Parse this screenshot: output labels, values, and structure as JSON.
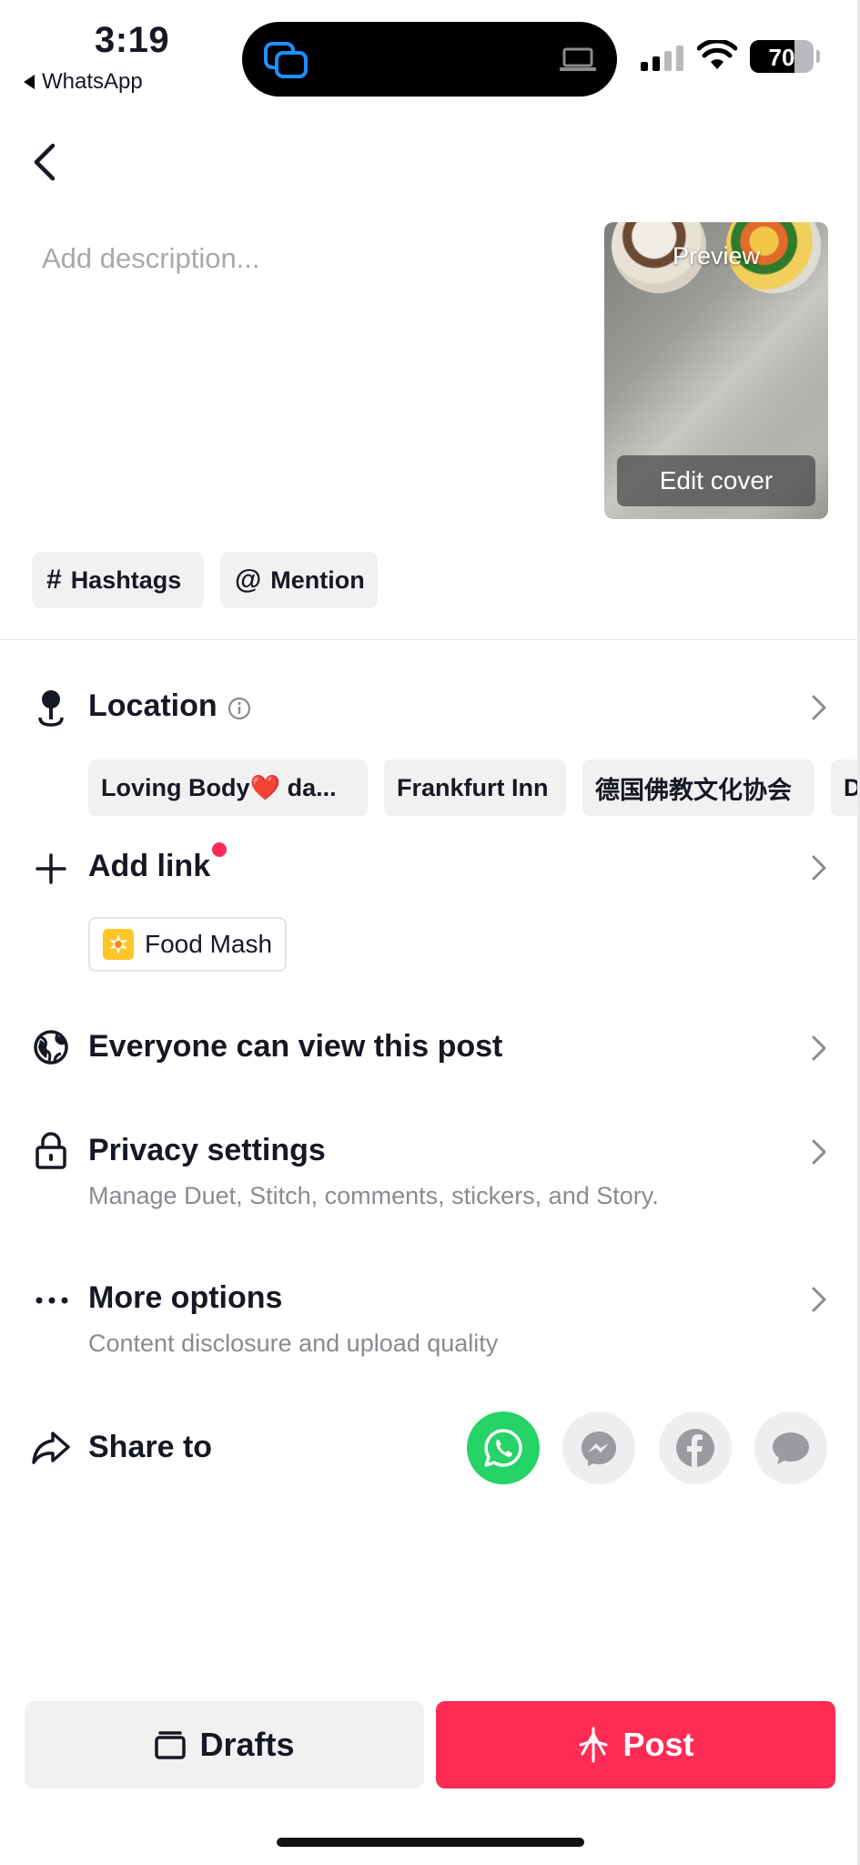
{
  "status_bar": {
    "time": "3:19",
    "back_app": "WhatsApp",
    "battery": "70",
    "battery_level": 0.7
  },
  "description": {
    "placeholder": "Add description..."
  },
  "cover": {
    "preview_label": "Preview",
    "edit_label": "Edit cover"
  },
  "chips": {
    "hashtags": "Hashtags",
    "mention": "Mention"
  },
  "location": {
    "title": "Location",
    "suggestions": [
      "Loving Body❤️ da...",
      "Frankfurt Inn",
      "德国佛教文化协会",
      "D"
    ]
  },
  "add_link": {
    "title": "Add link",
    "item": "Food Mash"
  },
  "visibility": {
    "title": "Everyone can view this post"
  },
  "privacy": {
    "title": "Privacy settings",
    "subtitle": "Manage Duet, Stitch, comments, stickers, and Story."
  },
  "more_options": {
    "title": "More options",
    "subtitle": "Content disclosure and upload quality"
  },
  "share": {
    "title": "Share to",
    "targets": [
      "whatsapp-icon",
      "messenger-icon",
      "facebook-icon",
      "message-icon"
    ]
  },
  "actions": {
    "drafts": "Drafts",
    "post": "Post"
  },
  "colors": {
    "accent": "#fe2c55",
    "whatsapp": "#25d366",
    "chip_bg": "#f1f1f2"
  }
}
